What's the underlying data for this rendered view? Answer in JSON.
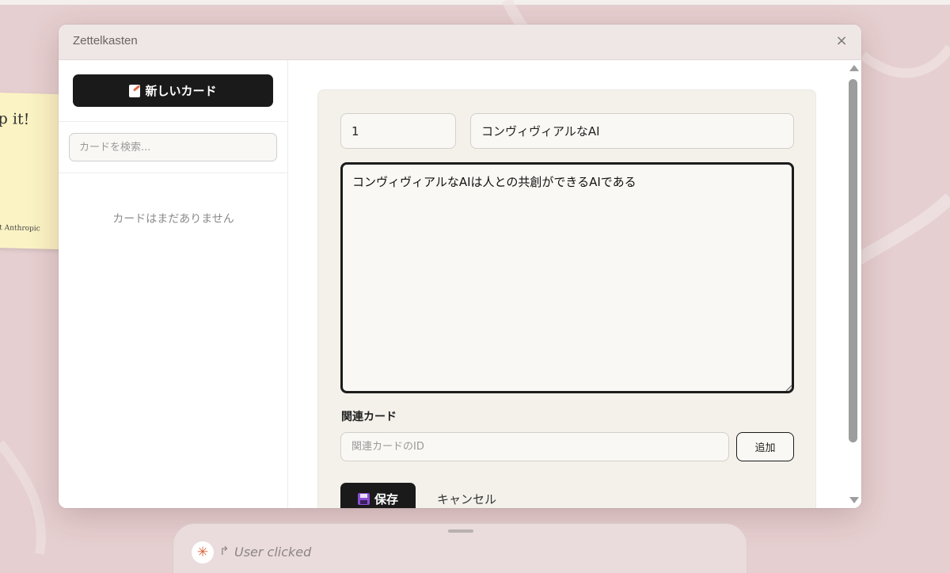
{
  "window": {
    "title": "Zettelkasten",
    "close_glyph": "×"
  },
  "background_note": {
    "heading": "p it!",
    "footer": "als at Anthropic"
  },
  "sidebar": {
    "new_card_label": "新しいカード",
    "new_card_icon": "memo-icon",
    "search_placeholder": "カードを検索...",
    "empty_message": "カードはまだありません"
  },
  "editor": {
    "id_value": "1",
    "title_value": "コンヴィヴィアルなAI",
    "body_value": "コンヴィヴィアルなAIは人との共創ができるAIである",
    "related_label": "関連カード",
    "related_placeholder": "関連カードのID",
    "add_label": "追加",
    "save_label": "保存",
    "save_icon": "floppy-disk-icon",
    "cancel_label": "キャンセル"
  },
  "status_tray": {
    "arrow": "↱",
    "text": "User clicked",
    "logo": "claude-logo-icon"
  },
  "colors": {
    "background": "#e6cfd0",
    "button_dark": "#1a1a1a",
    "panel": "#f3f1ea",
    "accent_logo": "#d9643f"
  }
}
